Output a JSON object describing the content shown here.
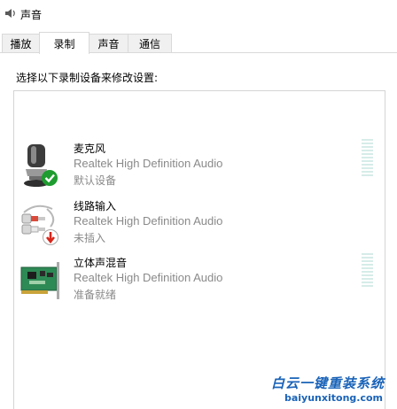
{
  "window": {
    "title": "声音"
  },
  "tabs": [
    {
      "label": "播放"
    },
    {
      "label": "录制"
    },
    {
      "label": "声音"
    },
    {
      "label": "通信"
    }
  ],
  "active_tab": "录制",
  "instruction": "选择以下录制设备来修改设置:",
  "devices": [
    {
      "name": "麦克风",
      "driver": "Realtek High Definition Audio",
      "status": "默认设备",
      "icon": "microphone-icon",
      "badge": "default-check-badge"
    },
    {
      "name": "线路输入",
      "driver": "Realtek High Definition Audio",
      "status": "未插入",
      "icon": "line-in-jack-icon",
      "badge": "unplugged-arrow-badge"
    },
    {
      "name": "立体声混音",
      "driver": "Realtek High Definition Audio",
      "status": "准备就绪",
      "icon": "sound-card-icon",
      "badge": ""
    }
  ],
  "watermark": {
    "line1": "白云一键重装系统",
    "line2": "baiyunxitong.com"
  },
  "colors": {
    "accent": "#1a63b8",
    "check": "#1e9c2f",
    "unplugged": "#d9261c",
    "meter": "#d6ece8"
  }
}
